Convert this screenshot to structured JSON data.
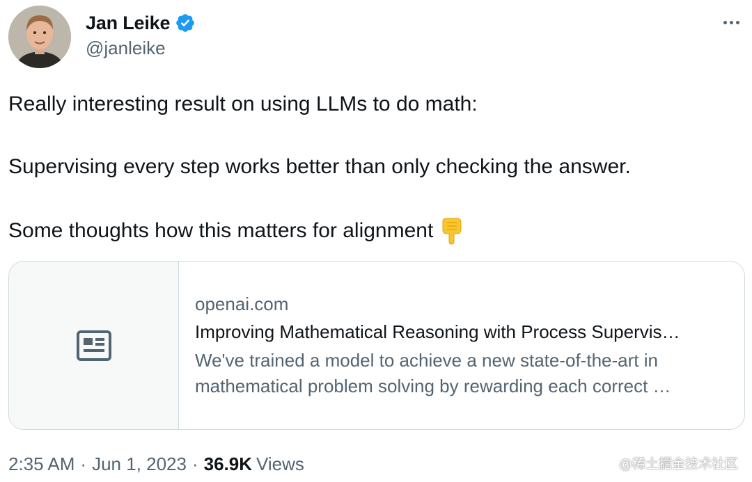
{
  "author": {
    "name": "Jan Leike",
    "handle": "@janleike",
    "verified": true
  },
  "tweet": {
    "lines": [
      "Really interesting result on using LLMs to do math:",
      "Supervising every step works better than only checking the answer.",
      "Some thoughts how this matters for alignment"
    ],
    "emoji": "backhand-index-pointing-down"
  },
  "link_card": {
    "domain": "openai.com",
    "title": "Improving Mathematical Reasoning with Process Supervis…",
    "description": "We've trained a model to achieve a new state-of-the-art in mathematical problem solving by rewarding each correct …",
    "thumbnail_icon": "article-icon"
  },
  "meta": {
    "time": "2:35 AM",
    "separator": "·",
    "date": "Jun 1, 2023",
    "views_count": "36.9K",
    "views_label": "Views"
  },
  "watermark": "@稀土掘金技术社区",
  "colors": {
    "verified": "#1d9bf0",
    "secondary_text": "#536471",
    "border": "#cfd9de"
  }
}
